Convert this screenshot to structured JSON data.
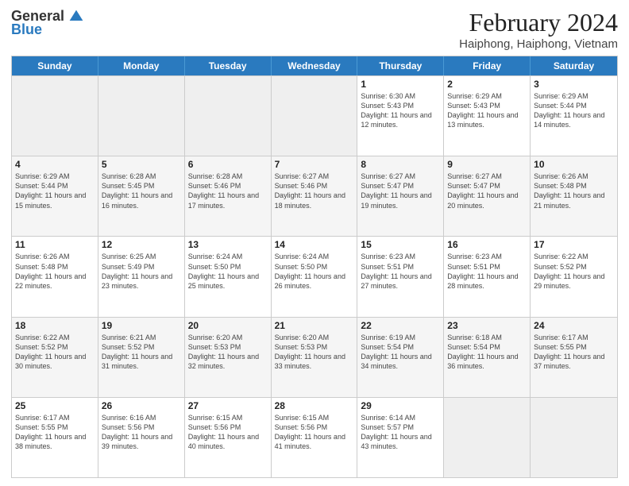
{
  "header": {
    "logo_general": "General",
    "logo_blue": "Blue",
    "month_year": "February 2024",
    "location": "Haiphong, Haiphong, Vietnam"
  },
  "days_of_week": [
    "Sunday",
    "Monday",
    "Tuesday",
    "Wednesday",
    "Thursday",
    "Friday",
    "Saturday"
  ],
  "weeks": [
    [
      {
        "day": "",
        "info": ""
      },
      {
        "day": "",
        "info": ""
      },
      {
        "day": "",
        "info": ""
      },
      {
        "day": "",
        "info": ""
      },
      {
        "day": "1",
        "info": "Sunrise: 6:30 AM\nSunset: 5:43 PM\nDaylight: 11 hours and 12 minutes."
      },
      {
        "day": "2",
        "info": "Sunrise: 6:29 AM\nSunset: 5:43 PM\nDaylight: 11 hours and 13 minutes."
      },
      {
        "day": "3",
        "info": "Sunrise: 6:29 AM\nSunset: 5:44 PM\nDaylight: 11 hours and 14 minutes."
      }
    ],
    [
      {
        "day": "4",
        "info": "Sunrise: 6:29 AM\nSunset: 5:44 PM\nDaylight: 11 hours and 15 minutes."
      },
      {
        "day": "5",
        "info": "Sunrise: 6:28 AM\nSunset: 5:45 PM\nDaylight: 11 hours and 16 minutes."
      },
      {
        "day": "6",
        "info": "Sunrise: 6:28 AM\nSunset: 5:46 PM\nDaylight: 11 hours and 17 minutes."
      },
      {
        "day": "7",
        "info": "Sunrise: 6:27 AM\nSunset: 5:46 PM\nDaylight: 11 hours and 18 minutes."
      },
      {
        "day": "8",
        "info": "Sunrise: 6:27 AM\nSunset: 5:47 PM\nDaylight: 11 hours and 19 minutes."
      },
      {
        "day": "9",
        "info": "Sunrise: 6:27 AM\nSunset: 5:47 PM\nDaylight: 11 hours and 20 minutes."
      },
      {
        "day": "10",
        "info": "Sunrise: 6:26 AM\nSunset: 5:48 PM\nDaylight: 11 hours and 21 minutes."
      }
    ],
    [
      {
        "day": "11",
        "info": "Sunrise: 6:26 AM\nSunset: 5:48 PM\nDaylight: 11 hours and 22 minutes."
      },
      {
        "day": "12",
        "info": "Sunrise: 6:25 AM\nSunset: 5:49 PM\nDaylight: 11 hours and 23 minutes."
      },
      {
        "day": "13",
        "info": "Sunrise: 6:24 AM\nSunset: 5:50 PM\nDaylight: 11 hours and 25 minutes."
      },
      {
        "day": "14",
        "info": "Sunrise: 6:24 AM\nSunset: 5:50 PM\nDaylight: 11 hours and 26 minutes."
      },
      {
        "day": "15",
        "info": "Sunrise: 6:23 AM\nSunset: 5:51 PM\nDaylight: 11 hours and 27 minutes."
      },
      {
        "day": "16",
        "info": "Sunrise: 6:23 AM\nSunset: 5:51 PM\nDaylight: 11 hours and 28 minutes."
      },
      {
        "day": "17",
        "info": "Sunrise: 6:22 AM\nSunset: 5:52 PM\nDaylight: 11 hours and 29 minutes."
      }
    ],
    [
      {
        "day": "18",
        "info": "Sunrise: 6:22 AM\nSunset: 5:52 PM\nDaylight: 11 hours and 30 minutes."
      },
      {
        "day": "19",
        "info": "Sunrise: 6:21 AM\nSunset: 5:52 PM\nDaylight: 11 hours and 31 minutes."
      },
      {
        "day": "20",
        "info": "Sunrise: 6:20 AM\nSunset: 5:53 PM\nDaylight: 11 hours and 32 minutes."
      },
      {
        "day": "21",
        "info": "Sunrise: 6:20 AM\nSunset: 5:53 PM\nDaylight: 11 hours and 33 minutes."
      },
      {
        "day": "22",
        "info": "Sunrise: 6:19 AM\nSunset: 5:54 PM\nDaylight: 11 hours and 34 minutes."
      },
      {
        "day": "23",
        "info": "Sunrise: 6:18 AM\nSunset: 5:54 PM\nDaylight: 11 hours and 36 minutes."
      },
      {
        "day": "24",
        "info": "Sunrise: 6:17 AM\nSunset: 5:55 PM\nDaylight: 11 hours and 37 minutes."
      }
    ],
    [
      {
        "day": "25",
        "info": "Sunrise: 6:17 AM\nSunset: 5:55 PM\nDaylight: 11 hours and 38 minutes."
      },
      {
        "day": "26",
        "info": "Sunrise: 6:16 AM\nSunset: 5:56 PM\nDaylight: 11 hours and 39 minutes."
      },
      {
        "day": "27",
        "info": "Sunrise: 6:15 AM\nSunset: 5:56 PM\nDaylight: 11 hours and 40 minutes."
      },
      {
        "day": "28",
        "info": "Sunrise: 6:15 AM\nSunset: 5:56 PM\nDaylight: 11 hours and 41 minutes."
      },
      {
        "day": "29",
        "info": "Sunrise: 6:14 AM\nSunset: 5:57 PM\nDaylight: 11 hours and 43 minutes."
      },
      {
        "day": "",
        "info": ""
      },
      {
        "day": "",
        "info": ""
      }
    ]
  ]
}
